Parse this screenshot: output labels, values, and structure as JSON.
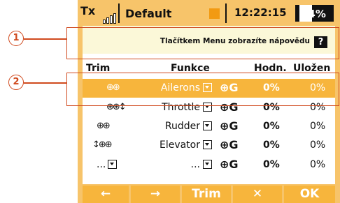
{
  "status": {
    "tx_label": "Tx",
    "model_name": "Default",
    "clock": "12:22:15",
    "battery": "64%"
  },
  "help": {
    "text": "Tlačítkem Menu zobrazíte nápovědu",
    "icon_label": "?"
  },
  "table": {
    "headers": [
      "Trim",
      "Funkce",
      "Hodn.",
      "Uložen"
    ],
    "rows": [
      {
        "function": "Ailerons",
        "value": "0%",
        "stored": "0%",
        "selected": true
      },
      {
        "function": "Throttle",
        "value": "0%",
        "stored": "0%",
        "selected": false
      },
      {
        "function": "Rudder",
        "value": "0%",
        "stored": "0%",
        "selected": false
      },
      {
        "function": "Elevator",
        "value": "0%",
        "stored": "0%",
        "selected": false
      },
      {
        "function": "...",
        "value": "0%",
        "stored": "0%",
        "selected": false
      }
    ],
    "trim_blank": "...",
    "global_mark": "G"
  },
  "bottom_bar": {
    "buttons": [
      "←",
      "→",
      "Trim",
      "tools-icon",
      "OK"
    ]
  },
  "callouts": [
    "1",
    "2"
  ],
  "colors": {
    "frame": "#f7c46a",
    "selected": "#f7b53c",
    "callout": "#d04a1e",
    "model_square": "#f29a12"
  }
}
